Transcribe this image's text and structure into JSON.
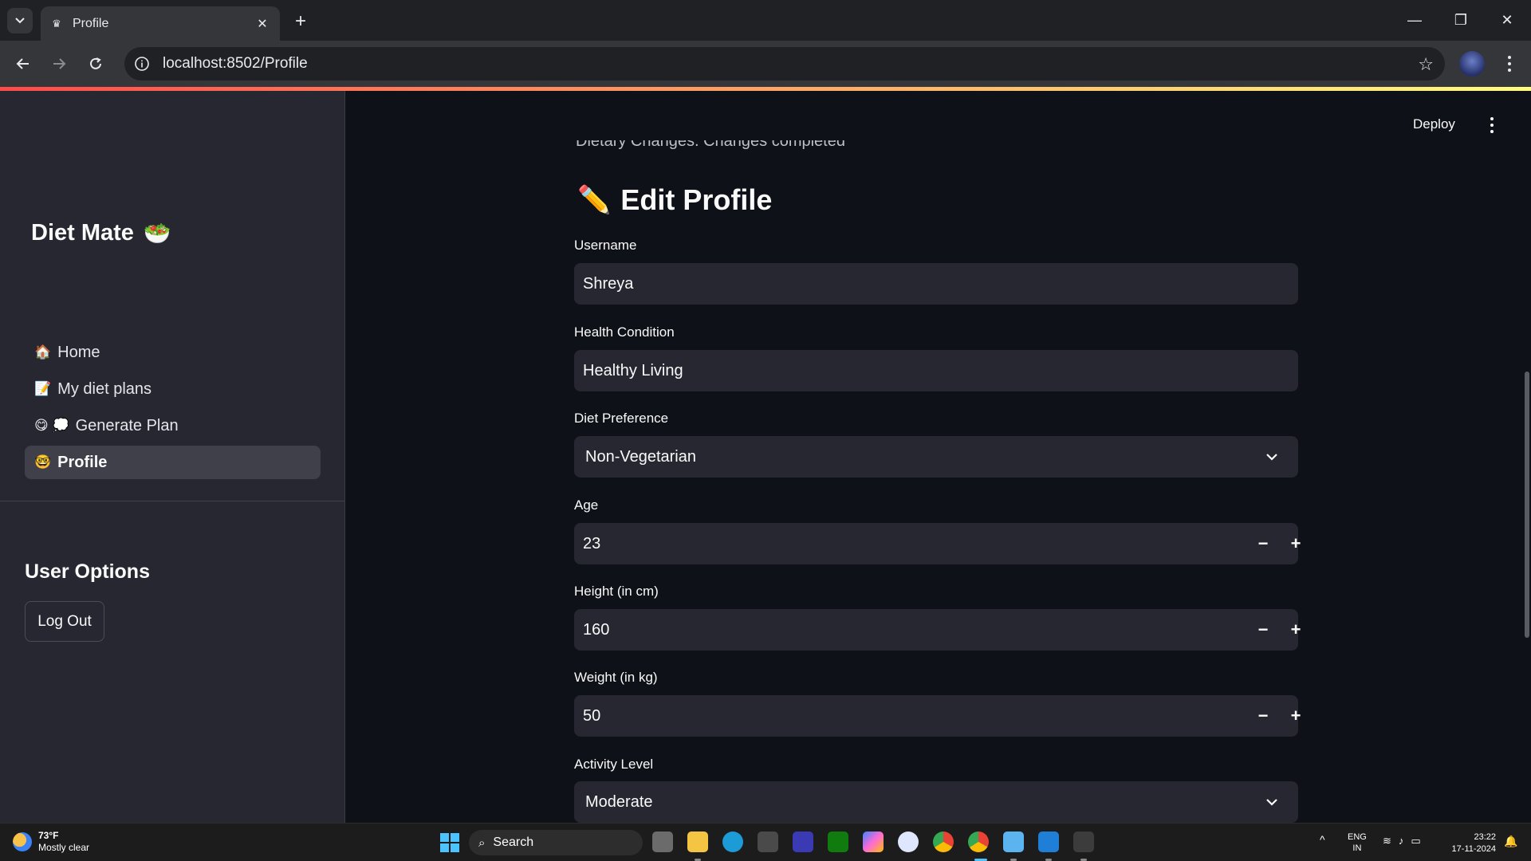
{
  "browser": {
    "tab_title": "Profile",
    "url": "localhost:8502/Profile"
  },
  "app": {
    "brand": "Diet Mate",
    "brand_emoji": "🥗",
    "nav": [
      {
        "icon": "🏠",
        "label": "Home"
      },
      {
        "icon": "📝",
        "label": "My diet plans"
      },
      {
        "icon": "😋 💭",
        "label": "Generate Plan"
      },
      {
        "icon": "🤓",
        "label": "Profile"
      }
    ],
    "user_options_title": "User Options",
    "logout_label": "Log Out",
    "deploy_label": "Deploy"
  },
  "main": {
    "clipped_text": "Dietary Changes. Changes completed",
    "title": "Edit Profile",
    "title_emoji": "✏️",
    "fields": {
      "username": {
        "label": "Username",
        "value": "Shreya"
      },
      "health": {
        "label": "Health Condition",
        "value": "Healthy Living"
      },
      "diet": {
        "label": "Diet Preference",
        "value": "Non-Vegetarian"
      },
      "age": {
        "label": "Age",
        "value": "23"
      },
      "height": {
        "label": "Height (in cm)",
        "value": "160"
      },
      "weight": {
        "label": "Weight (in kg)",
        "value": "50"
      },
      "activity": {
        "label": "Activity Level",
        "value": "Moderate"
      }
    },
    "minus": "−",
    "plus": "+"
  },
  "taskbar": {
    "weather_temp": "73°F",
    "weather_desc": "Mostly clear",
    "search_label": "Search",
    "lang_1": "ENG",
    "lang_2": "IN",
    "time": "23:22",
    "date": "17-11-2024"
  },
  "colors": {
    "accent_gradient_start": "#ff4b4b",
    "accent_gradient_end": "#fffd80",
    "sidebar_bg": "#262730",
    "main_bg": "#0e1117"
  }
}
